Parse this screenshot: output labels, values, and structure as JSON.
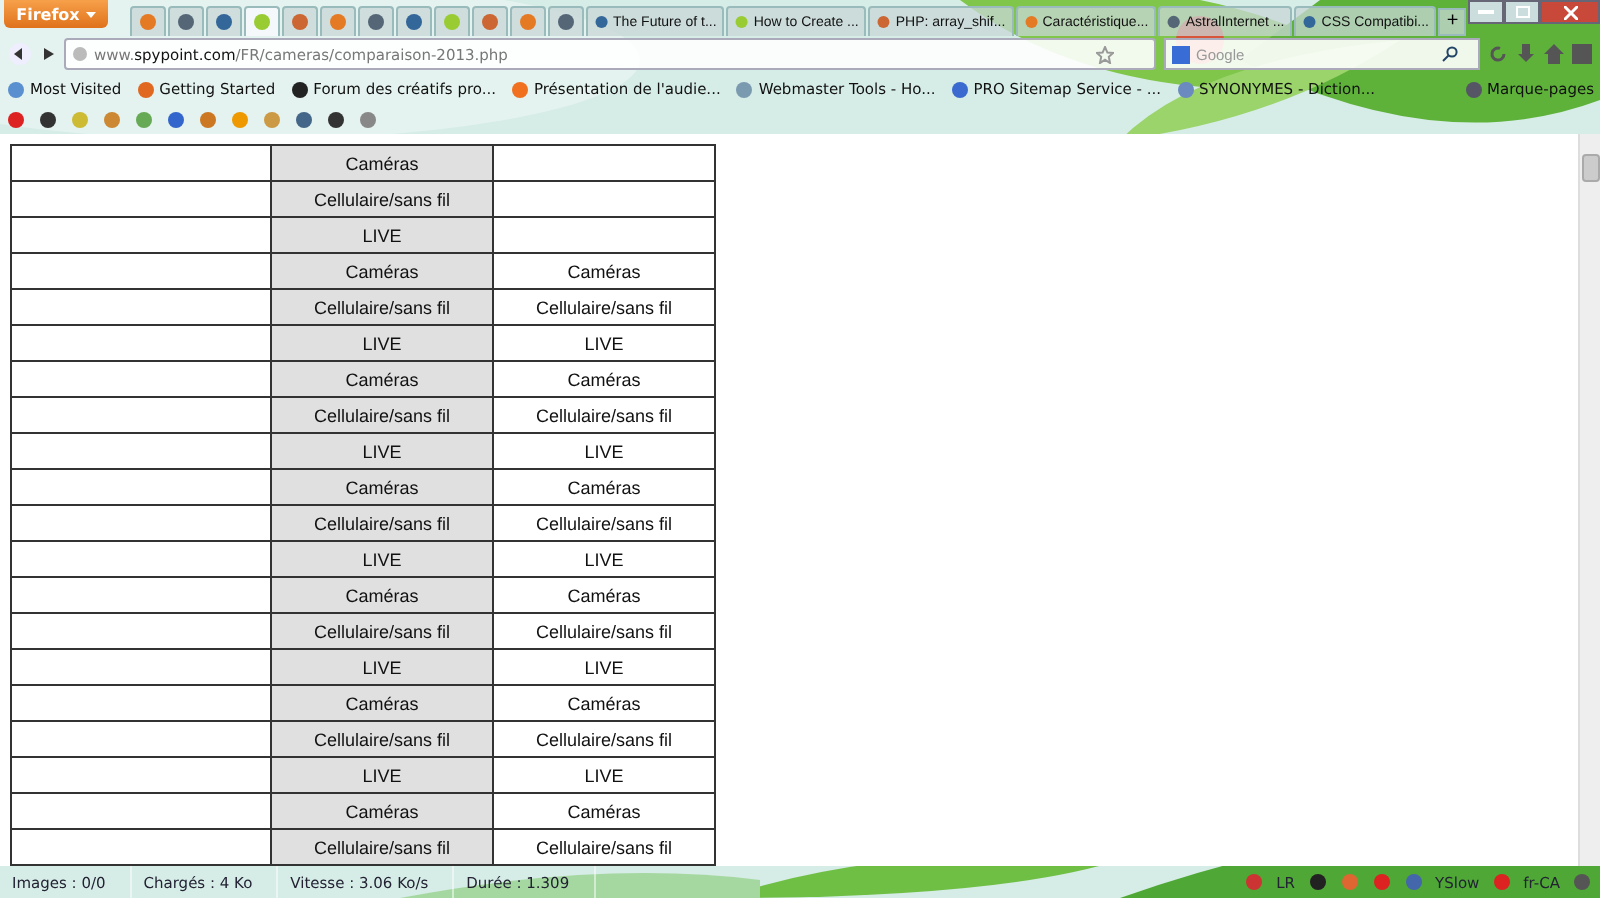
{
  "window": {
    "app_button": "Firefox"
  },
  "tabs": [
    {
      "selected": false
    },
    {
      "selected": false
    },
    {
      "selected": false
    },
    {
      "selected": true
    },
    {
      "selected": false
    },
    {
      "selected": false
    },
    {
      "selected": false
    },
    {
      "selected": false
    },
    {
      "selected": false
    },
    {
      "selected": false
    },
    {
      "selected": false
    },
    {
      "selected": false
    },
    {
      "title": "The Future of t...",
      "selected": false
    },
    {
      "title": "How to Create ...",
      "selected": false
    },
    {
      "title": "PHP: array_shif...",
      "selected": false
    },
    {
      "title": "Caractéristique...",
      "selected": false
    },
    {
      "title": "AstralInternet ...",
      "selected": false
    },
    {
      "title": "CSS Compatibi...",
      "selected": false
    }
  ],
  "new_tab": "+",
  "address_bar": {
    "url_prefix": "www.",
    "url_domain": "spypoint.com",
    "url_path": "/FR/cameras/comparaison-2013.php"
  },
  "search": {
    "placeholder": "Google"
  },
  "bookmarks": [
    "Most Visited",
    "Getting Started",
    "Forum des créatifs pro...",
    "Présentation de l'audie...",
    "Webmaster Tools - Ho...",
    "PRO Sitemap Service - ...",
    "SYNONYMES - Diction..."
  ],
  "bookmarks_menu": "Marque-pages",
  "table": {
    "rows": [
      {
        "column_2": "Caméras"
      },
      {
        "column_2": "Cellulaire/sans fil"
      },
      {
        "column_2": "LIVE"
      },
      {
        "column_2": "Caméras",
        "column_3": "Caméras"
      },
      {
        "column_2": "Cellulaire/sans fil",
        "column_3": "Cellulaire/sans fil"
      },
      {
        "column_2": "LIVE",
        "column_3": "LIVE"
      },
      {
        "column_2": "Caméras",
        "column_3": "Caméras"
      },
      {
        "column_2": "Cellulaire/sans fil",
        "column_3": "Cellulaire/sans fil"
      },
      {
        "column_2": "LIVE",
        "column_3": "LIVE"
      },
      {
        "column_2": "Caméras",
        "column_3": "Caméras"
      },
      {
        "column_2": "Cellulaire/sans fil",
        "column_3": "Cellulaire/sans fil"
      },
      {
        "column_2": "LIVE",
        "column_3": "LIVE"
      },
      {
        "column_2": "Caméras",
        "column_3": "Caméras"
      },
      {
        "column_2": "Cellulaire/sans fil",
        "column_3": "Cellulaire/sans fil"
      },
      {
        "column_2": "LIVE",
        "column_3": "LIVE"
      },
      {
        "column_2": "Caméras",
        "column_3": "Caméras"
      },
      {
        "column_2": "Cellulaire/sans fil",
        "column_3": "Cellulaire/sans fil"
      },
      {
        "column_2": "LIVE",
        "column_3": "LIVE"
      },
      {
        "column_2": "Caméras",
        "column_3": "Caméras"
      },
      {
        "column_2": "Cellulaire/sans fil",
        "column_3": "Cellulaire/sans fil"
      }
    ]
  },
  "status_bar": {
    "items": [
      "Images : 0/0",
      "Chargés : 4 Ko",
      "Vitesse : 3.06 Ko/s",
      "Durée : 1.309"
    ],
    "addons": [
      "LR",
      "YSlow",
      "fr-CA"
    ]
  }
}
